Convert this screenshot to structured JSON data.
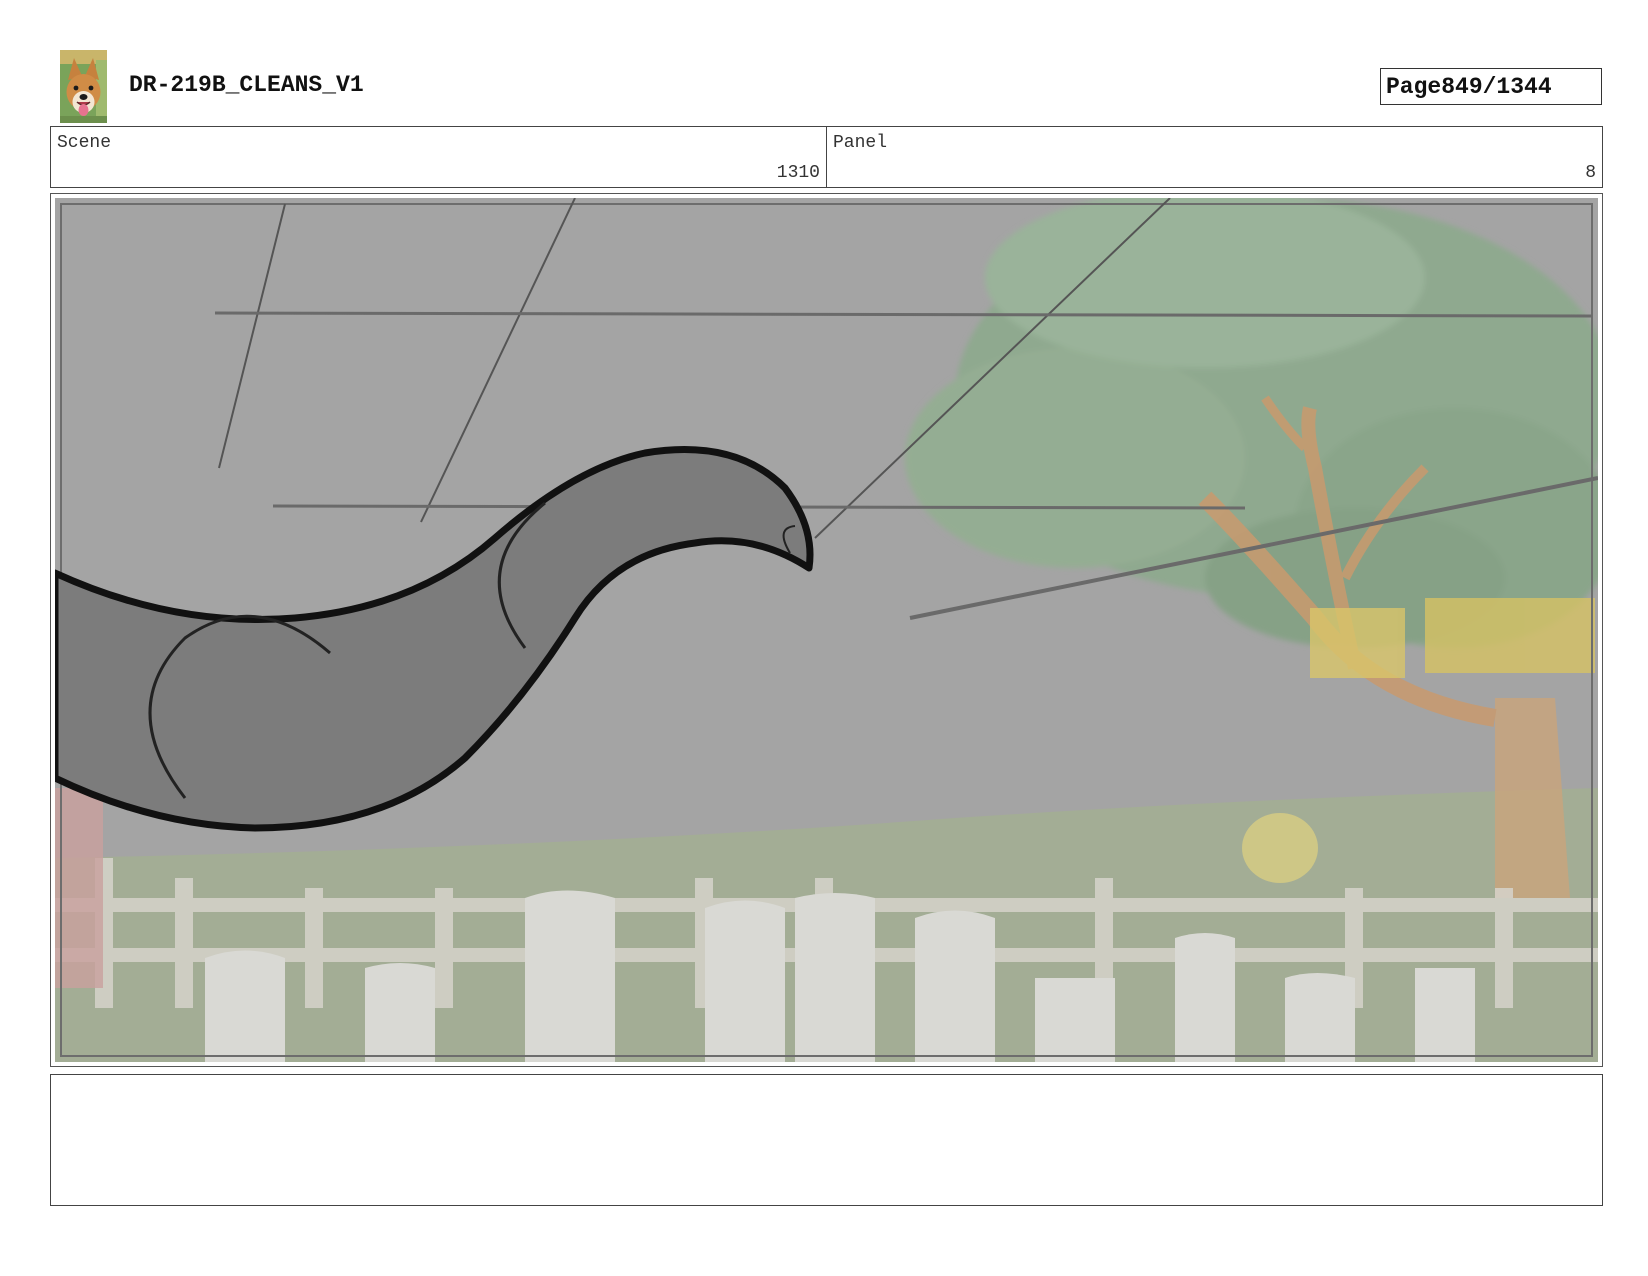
{
  "header": {
    "title": "DR-219B_CLEANS_V1",
    "page_label": "Page",
    "page_number": "849/1344",
    "logo_icon": "dog-face-icon"
  },
  "info": {
    "scene_label": "Scene",
    "scene_value": "1310",
    "panel_label": "Panel",
    "panel_value": "8"
  },
  "notes": {
    "text": ""
  },
  "colors": {
    "sky": "#a4a4a4",
    "foliage": "#8fa98f",
    "grass": "#a3ad95",
    "fence": "#d6d3cb",
    "shape_fill": "#7c7c7c",
    "shape_outline": "#111111"
  }
}
